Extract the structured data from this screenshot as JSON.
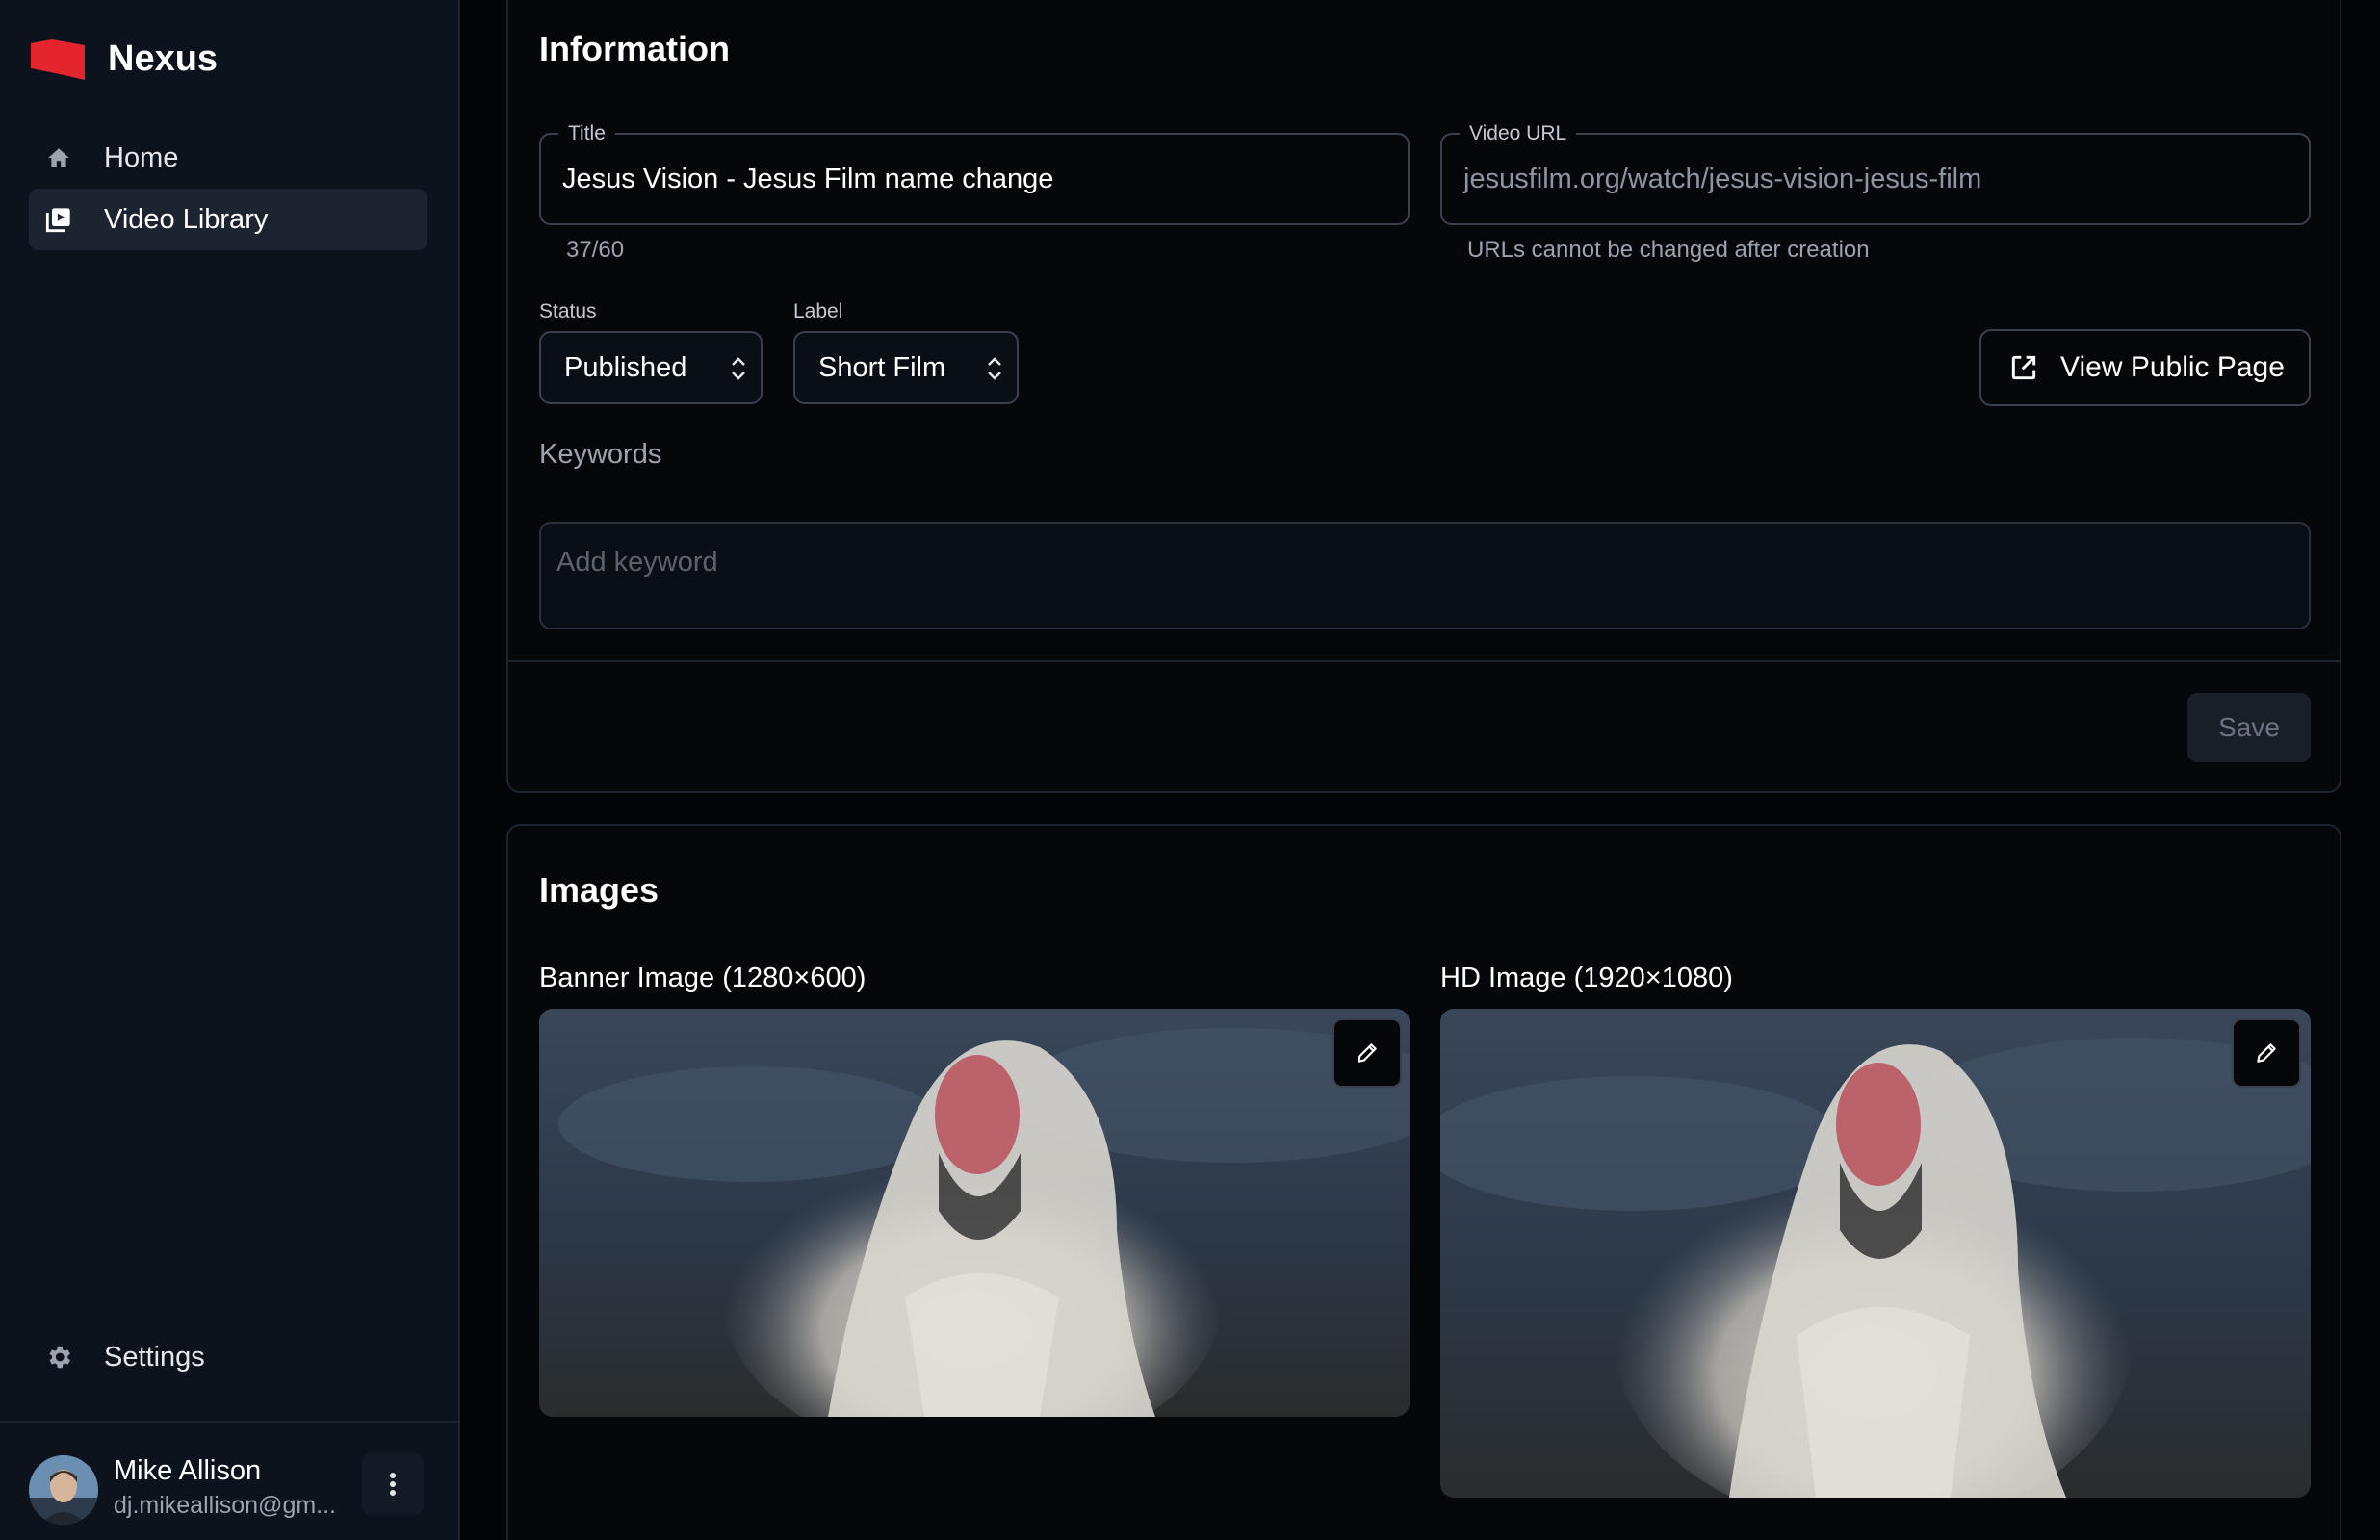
{
  "brand": {
    "name": "Nexus",
    "accent": "#e5252d"
  },
  "nav": {
    "items": [
      {
        "label": "Home",
        "icon": "home-icon"
      },
      {
        "label": "Video Library",
        "icon": "video-library-icon"
      }
    ],
    "active": "Video Library",
    "settings_label": "Settings"
  },
  "user": {
    "name": "Mike Allison",
    "email": "dj.mikeallison@gm..."
  },
  "information": {
    "heading": "Information",
    "title_field": {
      "label": "Title",
      "value": "Jesus Vision - Jesus Film name change",
      "counter": "37/60"
    },
    "url_field": {
      "label": "Video URL",
      "value": "jesusfilm.org/watch/jesus-vision-jesus-film",
      "helper": "URLs cannot be changed after creation"
    },
    "status": {
      "label": "Status",
      "value": "Published"
    },
    "label_select": {
      "label": "Label",
      "value": "Short Film"
    },
    "view_public_label": "View Public Page",
    "keywords": {
      "label": "Keywords",
      "placeholder": "Add keyword"
    },
    "save_label": "Save"
  },
  "images": {
    "heading": "Images",
    "banner_label": "Banner Image (1280×600)",
    "hd_label": "HD Image (1920×1080)"
  }
}
